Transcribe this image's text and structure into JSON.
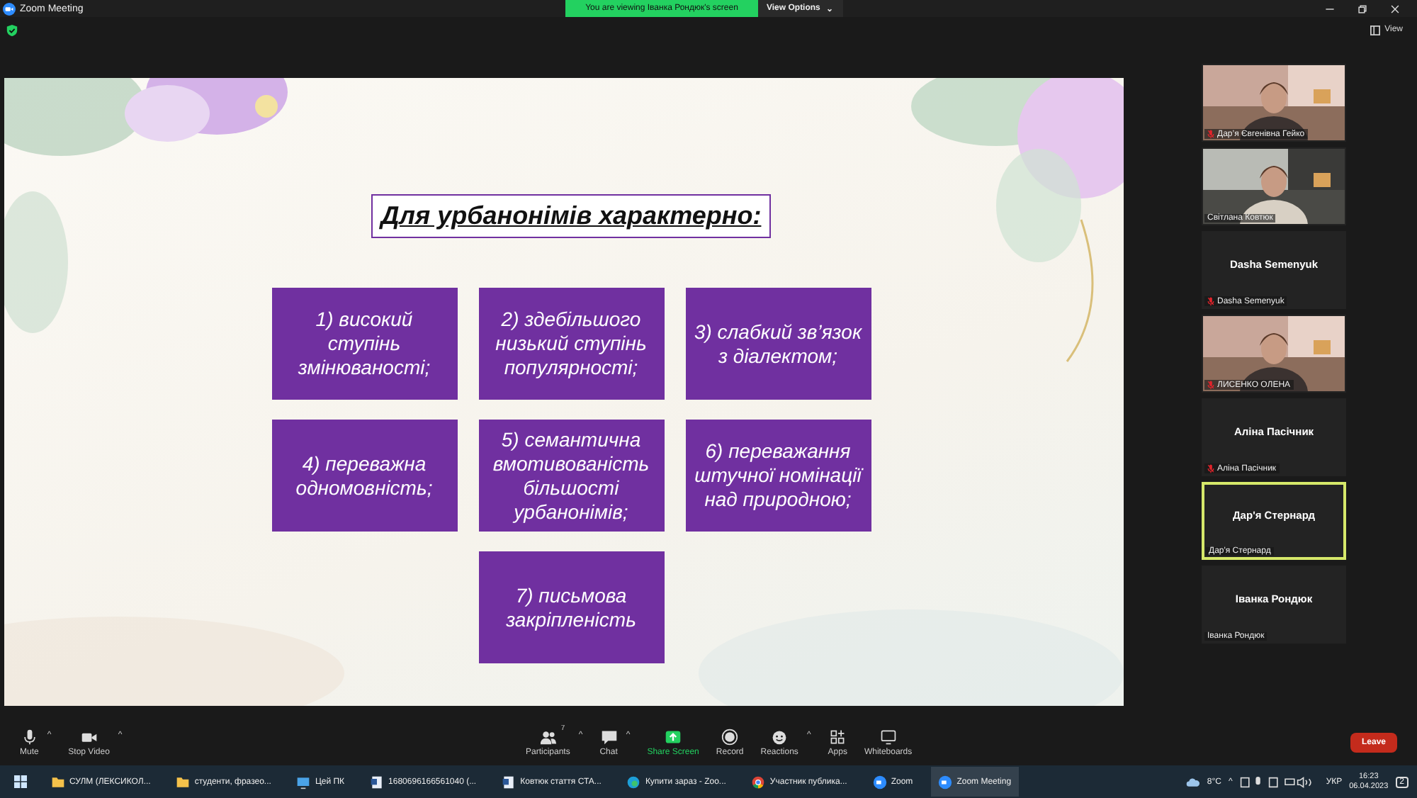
{
  "window": {
    "title": "Zoom Meeting"
  },
  "share_banner": {
    "text": "You are viewing Іванка Рондюк's screen",
    "options": "View Options",
    "caret": "⌄"
  },
  "toolbar": {
    "view": "View"
  },
  "slide": {
    "title": "Для урбанонімів характерно:",
    "cards": [
      "1) високий ступінь змінюваності;",
      "2) здебільшого низький ступінь популярності;",
      "3) слабкий зв’язок з діалектом;",
      "4) переважна одномовність;",
      "5) семантична вмотивованість більшості урбанонімів;",
      "6) переважання штучної номінації над природною;",
      "7) письмова закріпленість"
    ]
  },
  "participants": [
    {
      "kind": "video",
      "name": "Дар’я Євгенівна Гейко",
      "muted": true,
      "selected": false
    },
    {
      "kind": "video",
      "name": "Світлана Ковтюк",
      "muted": false,
      "selected": false
    },
    {
      "kind": "name",
      "title": "Dasha Semenyuk",
      "name": "Dasha Semenyuk",
      "muted": true,
      "selected": false
    },
    {
      "kind": "video",
      "name": "ЛИСЕНКО ОЛЕНА",
      "muted": true,
      "selected": false
    },
    {
      "kind": "name",
      "title": "Аліна Пасічник",
      "name": "Аліна Пасічник",
      "muted": true,
      "selected": false
    },
    {
      "kind": "name",
      "title": "Дар'я Стернард",
      "name": "Дар'я Стернард",
      "muted": false,
      "selected": true
    },
    {
      "kind": "name",
      "title": "Іванка Рондюк",
      "name": "Іванка Рондюк",
      "muted": false,
      "selected": false
    }
  ],
  "controls": [
    {
      "kind": "mic",
      "label": "Mute",
      "caret": "^"
    },
    {
      "kind": "camera",
      "label": "Stop Video",
      "caret": "^"
    },
    {
      "kind": "people",
      "label": "Participants",
      "badge": "7",
      "caret": "^"
    },
    {
      "kind": "chat",
      "label": "Chat",
      "caret": "^"
    },
    {
      "kind": "share",
      "label": "Share Screen"
    },
    {
      "kind": "record",
      "label": "Record"
    },
    {
      "kind": "reactions",
      "label": "Reactions",
      "caret": "^"
    },
    {
      "kind": "apps",
      "label": "Apps"
    },
    {
      "kind": "whiteboard",
      "label": "Whiteboards"
    }
  ],
  "leave": "Leave",
  "taskbar": {
    "items": [
      {
        "kind": "folder",
        "label": "СУЛМ (ЛЕКСИКОЛ...",
        "selected": false
      },
      {
        "kind": "folder",
        "label": "студенти, фразео...",
        "selected": false
      },
      {
        "kind": "computer",
        "label": "Цей ПК",
        "selected": false
      },
      {
        "kind": "document",
        "label": "1680696166561040 (...",
        "selected": false
      },
      {
        "kind": "document",
        "label": "Ковтюк стаття СТА...",
        "selected": false
      },
      {
        "kind": "edge",
        "label": "Купити зараз - Zoo...",
        "selected": false
      },
      {
        "kind": "chrome",
        "label": "Участник публика...",
        "selected": false
      },
      {
        "kind": "zoom",
        "label": "Zoom",
        "selected": false
      },
      {
        "kind": "zoom",
        "label": "Zoom Meeting",
        "selected": true
      }
    ],
    "weather": "8°C",
    "tray_caret": "^",
    "language": "УКР",
    "time": "16:23",
    "date": "06.04.2023",
    "notifications": "2"
  }
}
